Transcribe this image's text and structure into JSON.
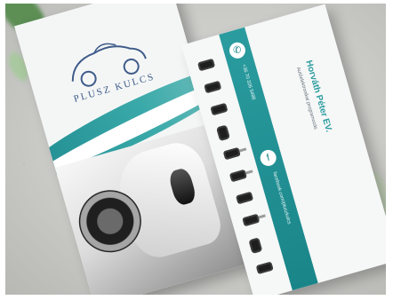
{
  "scene": {
    "background_color": "#cdcdca",
    "accent_teal": "#2a9c9f",
    "navy": "#3f5c8a"
  },
  "front_card": {
    "brand_name": "PLUSZ KULCS",
    "logo_icon": "car-outline-logo"
  },
  "back_card": {
    "owner_name": "Horváth Péter EV.",
    "subtitle": "Autóelektronikai programozás",
    "phone_label": "+36 70 326 5488",
    "facebook_label": "facebook.com/pluszkulcs",
    "phone_icon": "phone-icon",
    "facebook_icon": "facebook-icon",
    "key_icons": [
      "key-fob",
      "key-fob",
      "key-fob",
      "key-fob",
      "blade-key",
      "blade-key",
      "key-fob",
      "blade-key",
      "key-fob",
      "key-fob"
    ]
  }
}
